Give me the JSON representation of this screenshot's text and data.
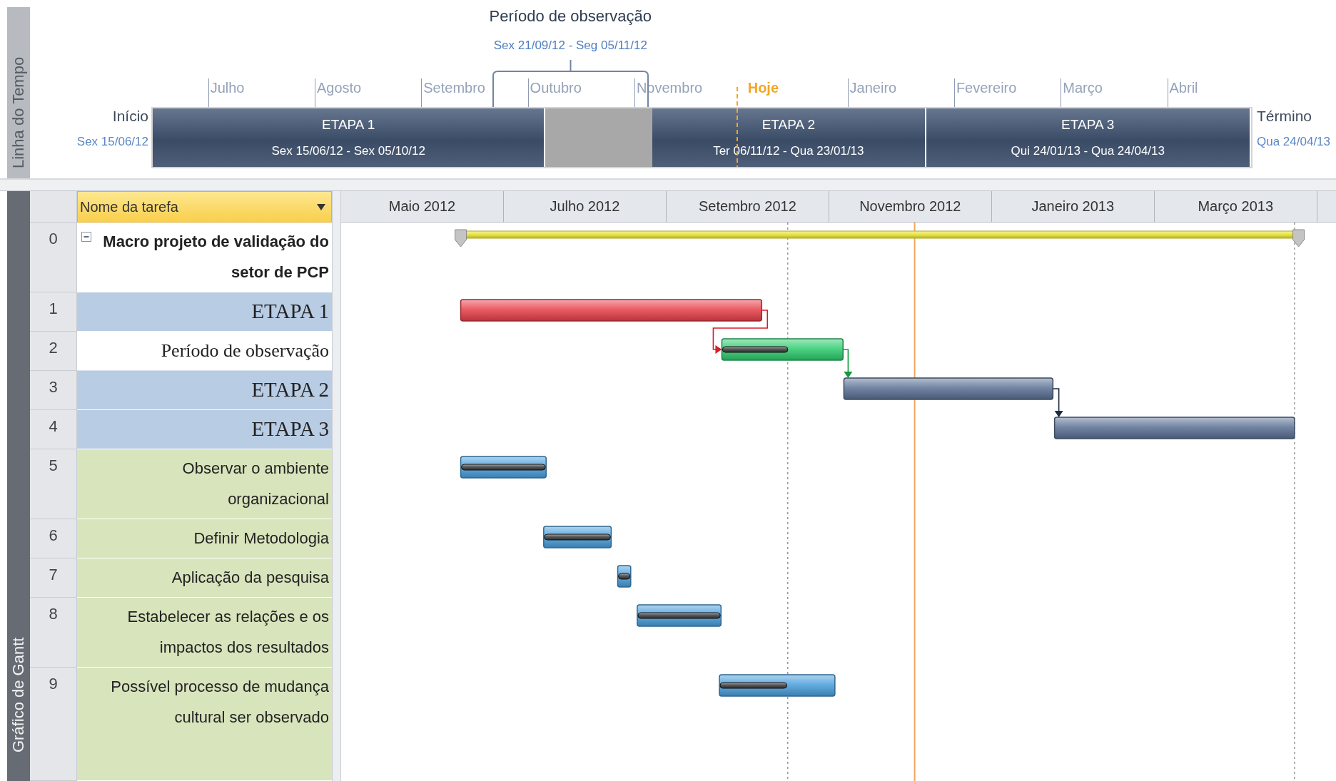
{
  "timeline": {
    "tab_label": "Linha do Tempo",
    "start_label": "Início",
    "start_date": "Sex 15/06/12",
    "finish_label": "Término",
    "finish_date": "Qua 24/04/13",
    "callouts": [
      {
        "name": "Período de observação",
        "dates": "Sex 21/09/12 - Seg 05/11/12"
      }
    ],
    "ticks": [
      {
        "label": "Julho",
        "kind": "month"
      },
      {
        "label": "Agosto",
        "kind": "month"
      },
      {
        "label": "Setembro",
        "kind": "month"
      },
      {
        "label": "Outubro",
        "kind": "month"
      },
      {
        "label": "Novembro",
        "kind": "month"
      },
      {
        "label": "Hoje",
        "kind": "today"
      },
      {
        "label": "Janeiro",
        "kind": "month"
      },
      {
        "label": "Fevereiro",
        "kind": "month"
      },
      {
        "label": "Março",
        "kind": "month"
      },
      {
        "label": "Abril",
        "kind": "month"
      }
    ],
    "bars": [
      {
        "name": "ETAPA 1",
        "dates": "Sex 15/06/12 - Sex 05/10/12"
      },
      {
        "name": "ETAPA 2",
        "dates": "Ter 06/11/12 - Qua 23/01/13"
      },
      {
        "name": "ETAPA 3",
        "dates": "Qui 24/01/13 - Qua 24/04/13"
      }
    ]
  },
  "gantt": {
    "tab_label": "Gráfico de Gantt",
    "column_header": "Nome da tarefa",
    "timescale": [
      "Maio 2012",
      "Julho 2012",
      "Setembro 2012",
      "Novembro 2012",
      "Janeiro 2013",
      "Março 2013"
    ],
    "tasks": [
      {
        "id": "0",
        "name": "Macro projeto de validação do setor de PCP",
        "kind": "summary",
        "expanded": true
      },
      {
        "id": "1",
        "name": "ETAPA 1",
        "kind": "stage"
      },
      {
        "id": "2",
        "name": "Período de observação",
        "kind": "observation"
      },
      {
        "id": "3",
        "name": "ETAPA 2",
        "kind": "stage"
      },
      {
        "id": "4",
        "name": "ETAPA 3",
        "kind": "stage"
      },
      {
        "id": "5",
        "name": "Observar o ambiente organizacional",
        "kind": "task"
      },
      {
        "id": "6",
        "name": "Definir Metodologia",
        "kind": "task"
      },
      {
        "id": "7",
        "name": "Aplicação da pesquisa",
        "kind": "task"
      },
      {
        "id": "8",
        "name": "Estabelecer as relações e os impactos dos resultados",
        "kind": "task"
      },
      {
        "id": "9",
        "name": "Possível processo de mudança cultural ser observado",
        "kind": "task"
      }
    ]
  }
}
